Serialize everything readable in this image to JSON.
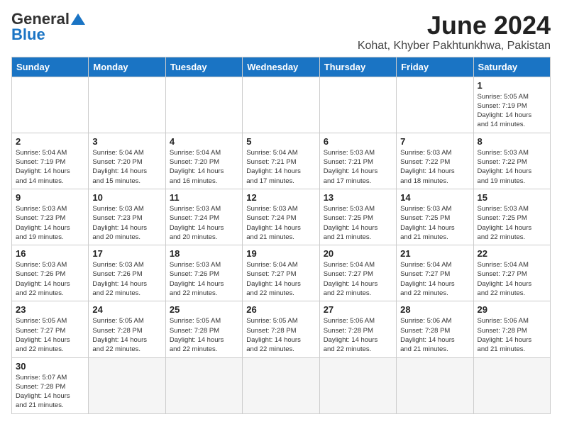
{
  "header": {
    "logo_general": "General",
    "logo_blue": "Blue",
    "month_title": "June 2024",
    "location": "Kohat, Khyber Pakhtunkhwa, Pakistan"
  },
  "weekdays": [
    "Sunday",
    "Monday",
    "Tuesday",
    "Wednesday",
    "Thursday",
    "Friday",
    "Saturday"
  ],
  "weeks": [
    [
      {
        "day": "",
        "info": ""
      },
      {
        "day": "",
        "info": ""
      },
      {
        "day": "",
        "info": ""
      },
      {
        "day": "",
        "info": ""
      },
      {
        "day": "",
        "info": ""
      },
      {
        "day": "",
        "info": ""
      },
      {
        "day": "1",
        "info": "Sunrise: 5:05 AM\nSunset: 7:19 PM\nDaylight: 14 hours\nand 14 minutes."
      }
    ],
    [
      {
        "day": "2",
        "info": "Sunrise: 5:04 AM\nSunset: 7:19 PM\nDaylight: 14 hours\nand 14 minutes."
      },
      {
        "day": "3",
        "info": "Sunrise: 5:04 AM\nSunset: 7:20 PM\nDaylight: 14 hours\nand 15 minutes."
      },
      {
        "day": "4",
        "info": "Sunrise: 5:04 AM\nSunset: 7:20 PM\nDaylight: 14 hours\nand 16 minutes."
      },
      {
        "day": "5",
        "info": "Sunrise: 5:04 AM\nSunset: 7:21 PM\nDaylight: 14 hours\nand 17 minutes."
      },
      {
        "day": "6",
        "info": "Sunrise: 5:03 AM\nSunset: 7:21 PM\nDaylight: 14 hours\nand 17 minutes."
      },
      {
        "day": "7",
        "info": "Sunrise: 5:03 AM\nSunset: 7:22 PM\nDaylight: 14 hours\nand 18 minutes."
      },
      {
        "day": "8",
        "info": "Sunrise: 5:03 AM\nSunset: 7:22 PM\nDaylight: 14 hours\nand 19 minutes."
      }
    ],
    [
      {
        "day": "9",
        "info": "Sunrise: 5:03 AM\nSunset: 7:23 PM\nDaylight: 14 hours\nand 19 minutes."
      },
      {
        "day": "10",
        "info": "Sunrise: 5:03 AM\nSunset: 7:23 PM\nDaylight: 14 hours\nand 20 minutes."
      },
      {
        "day": "11",
        "info": "Sunrise: 5:03 AM\nSunset: 7:24 PM\nDaylight: 14 hours\nand 20 minutes."
      },
      {
        "day": "12",
        "info": "Sunrise: 5:03 AM\nSunset: 7:24 PM\nDaylight: 14 hours\nand 21 minutes."
      },
      {
        "day": "13",
        "info": "Sunrise: 5:03 AM\nSunset: 7:25 PM\nDaylight: 14 hours\nand 21 minutes."
      },
      {
        "day": "14",
        "info": "Sunrise: 5:03 AM\nSunset: 7:25 PM\nDaylight: 14 hours\nand 21 minutes."
      },
      {
        "day": "15",
        "info": "Sunrise: 5:03 AM\nSunset: 7:25 PM\nDaylight: 14 hours\nand 22 minutes."
      }
    ],
    [
      {
        "day": "16",
        "info": "Sunrise: 5:03 AM\nSunset: 7:26 PM\nDaylight: 14 hours\nand 22 minutes."
      },
      {
        "day": "17",
        "info": "Sunrise: 5:03 AM\nSunset: 7:26 PM\nDaylight: 14 hours\nand 22 minutes."
      },
      {
        "day": "18",
        "info": "Sunrise: 5:03 AM\nSunset: 7:26 PM\nDaylight: 14 hours\nand 22 minutes."
      },
      {
        "day": "19",
        "info": "Sunrise: 5:04 AM\nSunset: 7:27 PM\nDaylight: 14 hours\nand 22 minutes."
      },
      {
        "day": "20",
        "info": "Sunrise: 5:04 AM\nSunset: 7:27 PM\nDaylight: 14 hours\nand 22 minutes."
      },
      {
        "day": "21",
        "info": "Sunrise: 5:04 AM\nSunset: 7:27 PM\nDaylight: 14 hours\nand 22 minutes."
      },
      {
        "day": "22",
        "info": "Sunrise: 5:04 AM\nSunset: 7:27 PM\nDaylight: 14 hours\nand 22 minutes."
      }
    ],
    [
      {
        "day": "23",
        "info": "Sunrise: 5:05 AM\nSunset: 7:27 PM\nDaylight: 14 hours\nand 22 minutes."
      },
      {
        "day": "24",
        "info": "Sunrise: 5:05 AM\nSunset: 7:28 PM\nDaylight: 14 hours\nand 22 minutes."
      },
      {
        "day": "25",
        "info": "Sunrise: 5:05 AM\nSunset: 7:28 PM\nDaylight: 14 hours\nand 22 minutes."
      },
      {
        "day": "26",
        "info": "Sunrise: 5:05 AM\nSunset: 7:28 PM\nDaylight: 14 hours\nand 22 minutes."
      },
      {
        "day": "27",
        "info": "Sunrise: 5:06 AM\nSunset: 7:28 PM\nDaylight: 14 hours\nand 22 minutes."
      },
      {
        "day": "28",
        "info": "Sunrise: 5:06 AM\nSunset: 7:28 PM\nDaylight: 14 hours\nand 21 minutes."
      },
      {
        "day": "29",
        "info": "Sunrise: 5:06 AM\nSunset: 7:28 PM\nDaylight: 14 hours\nand 21 minutes."
      }
    ],
    [
      {
        "day": "30",
        "info": "Sunrise: 5:07 AM\nSunset: 7:28 PM\nDaylight: 14 hours\nand 21 minutes."
      },
      {
        "day": "",
        "info": ""
      },
      {
        "day": "",
        "info": ""
      },
      {
        "day": "",
        "info": ""
      },
      {
        "day": "",
        "info": ""
      },
      {
        "day": "",
        "info": ""
      },
      {
        "day": "",
        "info": ""
      }
    ]
  ]
}
